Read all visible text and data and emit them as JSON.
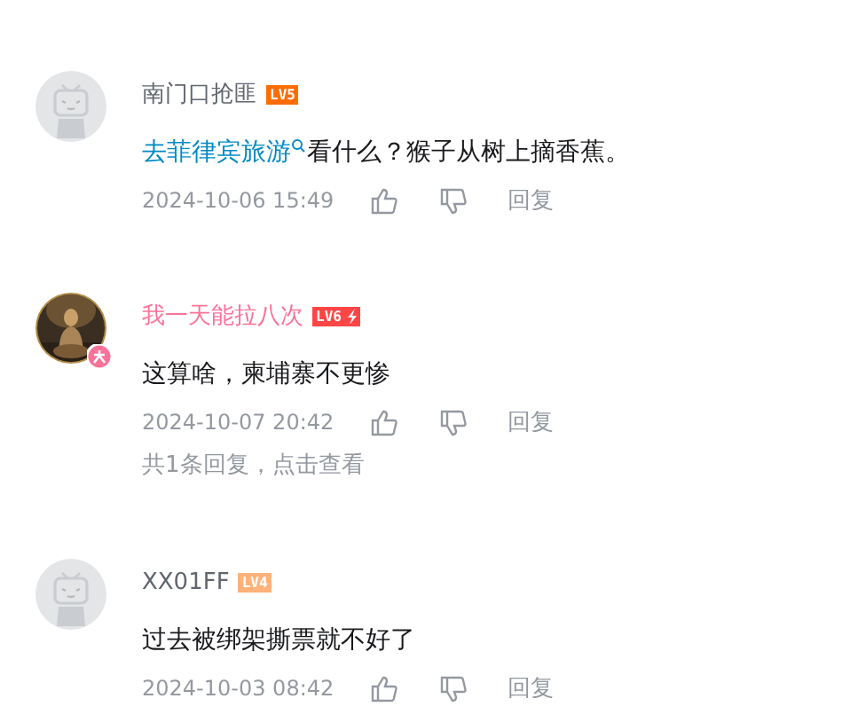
{
  "comments": [
    {
      "user": {
        "name": "南门口抢匪",
        "vip": false,
        "avatar": {
          "kind": "default"
        },
        "level": {
          "label": "LV5",
          "color": "#ff6c00",
          "lightning": false
        }
      },
      "content": [
        {
          "kind": "link",
          "text": "去菲律宾旅游"
        },
        {
          "kind": "text",
          "text": "看什么？猴子从树上摘香蕉。"
        }
      ],
      "time": "2024-10-06 15:49",
      "reply_action": "回复"
    },
    {
      "user": {
        "name": "我一天能拉八次",
        "vip": true,
        "level": {
          "label": "LV6",
          "color": "#ff4545",
          "lightning": true
        }
      },
      "content": [
        {
          "kind": "text",
          "text": "这算啥，柬埔寨不更惨"
        }
      ],
      "time": "2024-10-07 20:42",
      "reply_action": "回复",
      "replies_link": "共1条回复，点击查看"
    },
    {
      "user": {
        "name": "XX01FF",
        "vip": false,
        "avatar": {
          "kind": "default"
        },
        "level": {
          "label": "LV4",
          "color": "#ffb27a",
          "lightning": false
        }
      },
      "content": [
        {
          "kind": "text",
          "text": "过去被绑架撕票就不好了"
        }
      ],
      "time": "2024-10-03 08:42",
      "reply_action": "回复"
    }
  ]
}
